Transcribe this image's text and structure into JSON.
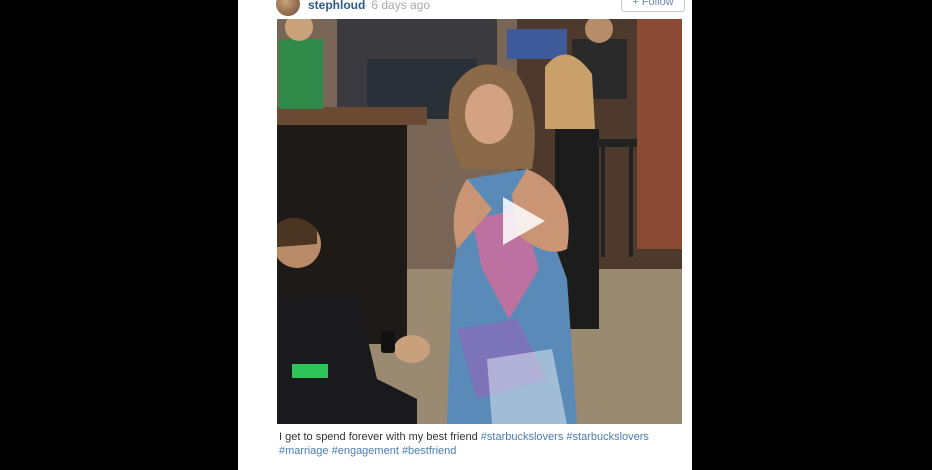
{
  "post": {
    "username": "stephloud",
    "timestamp": "6 days ago",
    "follow_label": "+ Follow",
    "caption_text": "I get to spend forever with my best friend",
    "hashtags": [
      "#starbuckslovers",
      "#starbuckslovers",
      "#marriage",
      "#engagement",
      "#bestfriend"
    ]
  },
  "colors": {
    "background": "#000000",
    "card": "#ffffff",
    "username": "#2d5a87",
    "hashtag": "#4a7cb5",
    "follow_text": "#6b8cb3"
  },
  "icons": {
    "play": "play-icon",
    "avatar": "avatar"
  }
}
